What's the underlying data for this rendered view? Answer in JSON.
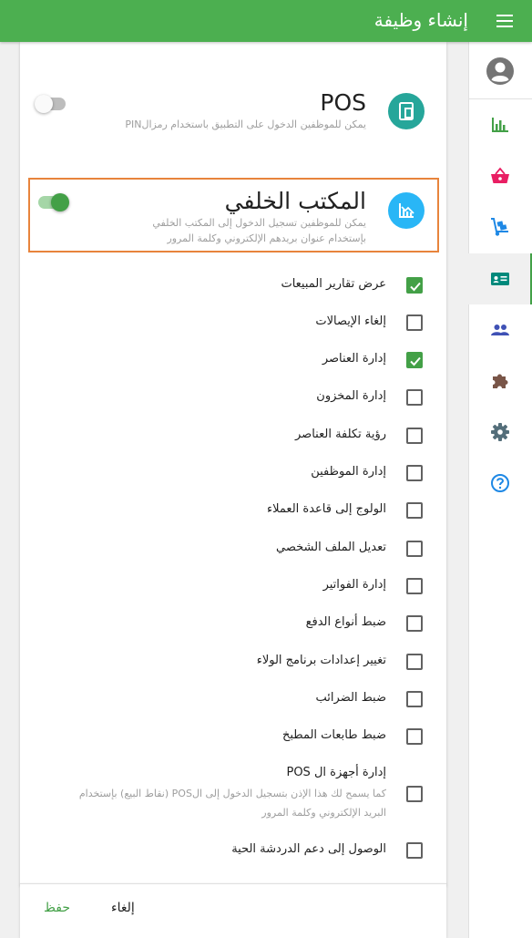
{
  "appbar": {
    "title": "إنشاء وظيفة",
    "menu_icon": "menu-icon"
  },
  "sidenav": {
    "items": [
      {
        "name": "reports",
        "icon": "bar-chart-icon",
        "color": "#43a047",
        "active": false
      },
      {
        "name": "sales",
        "icon": "basket-icon",
        "color": "#e91e63",
        "active": false
      },
      {
        "name": "inventory",
        "icon": "dolly-icon",
        "color": "#1e88e5",
        "active": false
      },
      {
        "name": "employees",
        "icon": "badge-icon",
        "color": "#00897b",
        "active": true
      },
      {
        "name": "customers",
        "icon": "people-icon",
        "color": "#3f51b5",
        "active": false
      },
      {
        "name": "integrations",
        "icon": "puzzle-icon",
        "color": "#795548",
        "active": false
      },
      {
        "name": "settings",
        "icon": "gear-icon",
        "color": "#546e7a",
        "active": false
      },
      {
        "name": "help",
        "icon": "help-icon",
        "color": "#1e88e5",
        "active": false
      }
    ]
  },
  "pos_section": {
    "title": "POS",
    "description": "يمكن للموظفين الدخول على التطبيق باستخدام رمزالPIN",
    "icon": "pos-device-icon",
    "icon_color": "#26a69a",
    "enabled": false
  },
  "backoffice_section": {
    "title": "المكتب الخلفي",
    "description_line1": "يمكن للموظفين تسجيل الدخول إلى المكتب الخلفي",
    "description_line2": "بإستخدام عنوان بريدهم الإلكتروني وكلمة المرور",
    "icon": "backoffice-chart-icon",
    "icon_color": "#29b6f6",
    "enabled": true,
    "highlight_color": "#e8843c"
  },
  "permissions": [
    {
      "label": "عرض تقارير المبيعات",
      "checked": true
    },
    {
      "label": "إلغاء الإيصالات",
      "checked": false
    },
    {
      "label": "إدارة العناصر",
      "checked": true
    },
    {
      "label": "إدارة المخزون",
      "checked": false
    },
    {
      "label": "رؤية تكلفة العناصر",
      "checked": false
    },
    {
      "label": "إدارة الموظفين",
      "checked": false
    },
    {
      "label": "الولوج إلى قاعدة العملاء",
      "checked": false
    },
    {
      "label": "تعديل الملف الشخصي",
      "checked": false
    },
    {
      "label": "إدارة الفواتير",
      "checked": false
    },
    {
      "label": "ضبط أنواع الدفع",
      "checked": false
    },
    {
      "label": "تغيير إعدادات برنامج الولاء",
      "checked": false
    },
    {
      "label": "ضبط الضرائب",
      "checked": false
    },
    {
      "label": "ضبط طابعات المطبخ",
      "checked": false
    },
    {
      "label": "إدارة أجهزة ال POS",
      "sublabel_line1": "كما يسمح لك هذا الإذن بتسجيل الدخول إلى الPOS (نقاط البيع) بإستخدام",
      "sublabel_line2": "البريد الإلكتروني وكلمة المرور",
      "checked": false
    },
    {
      "label": "الوصول إلى دعم الدردشة الحية",
      "checked": false
    }
  ],
  "footer": {
    "cancel_label": "إلغاء",
    "save_label": "حفظ"
  },
  "colors": {
    "primary": "#4caf50",
    "accent": "#43a047"
  }
}
